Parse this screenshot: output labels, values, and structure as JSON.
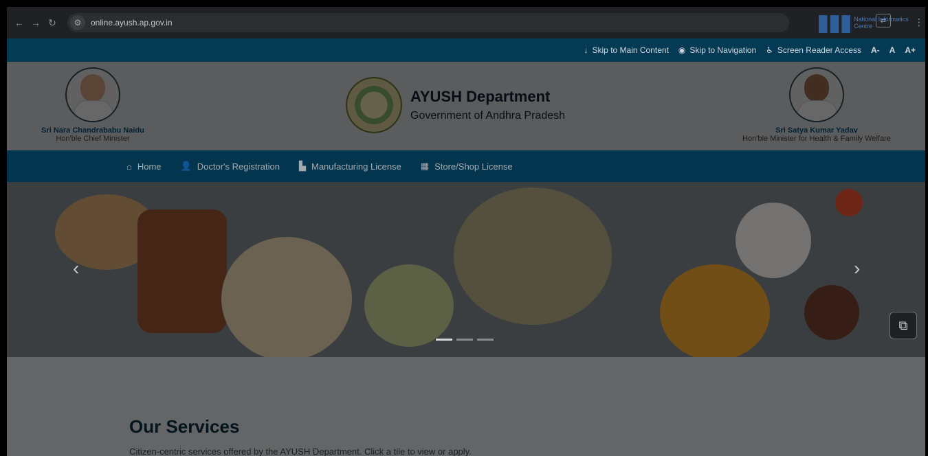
{
  "browser": {
    "url": "online.ayush.ap.gov.in",
    "nic_logo_text": "National Informatics Centre",
    "icons": [
      "back-icon",
      "forward-icon",
      "reload-icon",
      "site-settings-icon",
      "translate-icon",
      "more-menu-icon"
    ]
  },
  "accessibility": {
    "skip_main": "Skip to Main Content",
    "skip_nav": "Skip to Navigation",
    "screen_reader": "Screen Reader Access",
    "font_minus": "A-",
    "font_normal": "A",
    "font_plus": "A+"
  },
  "header": {
    "left_leader": {
      "name": "Sri Nara Chandrababu Naidu",
      "role": "Hon'ble Chief Minister"
    },
    "brand": {
      "title": "AYUSH Department",
      "subtitle": "Government of Andhra Pradesh"
    },
    "right_leader": {
      "name": "Sri Satya Kumar Yadav",
      "role": "Hon'ble Minister for Health & Family Welfare"
    }
  },
  "nav": {
    "items": [
      {
        "label": "Home",
        "icon": "home-icon"
      },
      {
        "label": "Doctor's Registration",
        "icon": "doctor-icon"
      },
      {
        "label": "Manufacturing License",
        "icon": "factory-icon"
      },
      {
        "label": "Store/Shop License",
        "icon": "store-icon"
      }
    ]
  },
  "banner": {
    "slides": 3,
    "active_slide": 1
  },
  "services": {
    "title": "Our Services",
    "subtitle": "Citizen-centric services offered by the AYUSH Department. Click a tile to view or apply."
  },
  "colors": {
    "topstrip": "#053a55",
    "nav": "#064c6f",
    "brand_blue": "#07507a"
  }
}
